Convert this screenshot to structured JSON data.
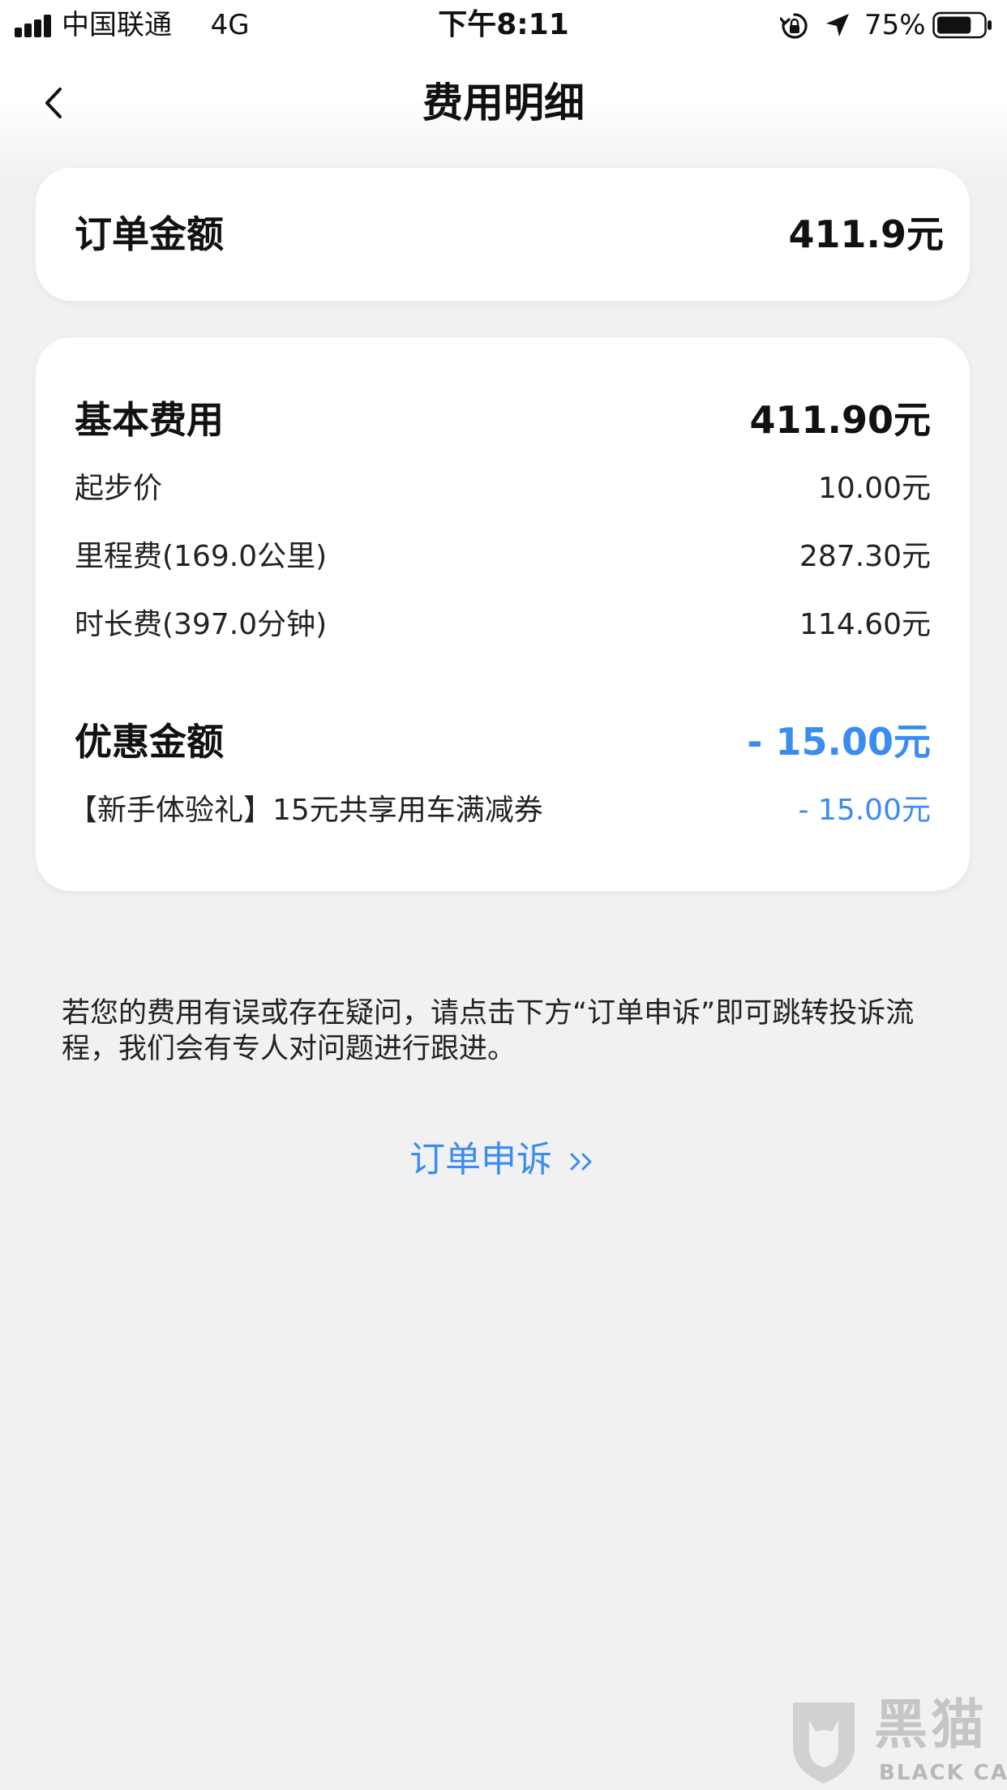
{
  "status_bar": {
    "carrier": "中国联通",
    "network": "4G",
    "time": "下午8:11",
    "battery_percent": "75%",
    "battery_level": 0.75
  },
  "nav": {
    "title": "费用明细",
    "back_icon": "chevron-left-icon"
  },
  "order_total": {
    "label": "订单金额",
    "value": "411.9元"
  },
  "basic_fee": {
    "label": "基本费用",
    "value": "411.90元",
    "items": [
      {
        "label": "起步价",
        "value": "10.00元"
      },
      {
        "label": "里程费(169.0公里)",
        "value": "287.30元"
      },
      {
        "label": "时长费(397.0分钟)",
        "value": "114.60元"
      }
    ]
  },
  "discount": {
    "label": "优惠金额",
    "value": "- 15.00元",
    "items": [
      {
        "label": "【新手体验礼】15元共享用车满减券",
        "value": "- 15.00元"
      }
    ]
  },
  "note": "若您的费用有误或存在疑问，请点击下方“订单申诉”即可跳转投诉流程，我们会有专人对问题进行跟进。",
  "appeal": {
    "label": "订单申诉",
    "icon": "double-chevron-right-icon"
  },
  "watermark": {
    "text": "黑猫",
    "subtext": "BLACK CAT"
  },
  "colors": {
    "accent": "#3b8cf1",
    "background": "#f1f1f1",
    "card": "#ffffff"
  }
}
